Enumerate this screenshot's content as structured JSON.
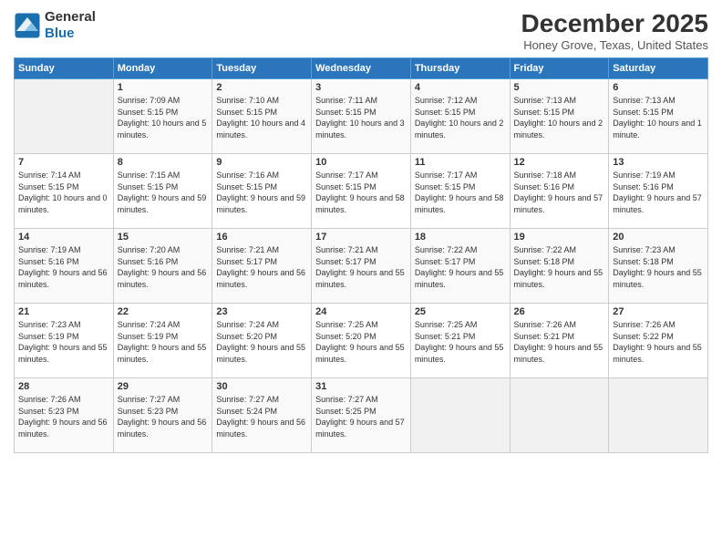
{
  "logo": {
    "line1": "General",
    "line2": "Blue"
  },
  "title": "December 2025",
  "subtitle": "Honey Grove, Texas, United States",
  "days_header": [
    "Sunday",
    "Monday",
    "Tuesday",
    "Wednesday",
    "Thursday",
    "Friday",
    "Saturday"
  ],
  "weeks": [
    [
      {
        "num": "",
        "sunrise": "",
        "sunset": "",
        "daylight": ""
      },
      {
        "num": "1",
        "sunrise": "Sunrise: 7:09 AM",
        "sunset": "Sunset: 5:15 PM",
        "daylight": "Daylight: 10 hours and 5 minutes."
      },
      {
        "num": "2",
        "sunrise": "Sunrise: 7:10 AM",
        "sunset": "Sunset: 5:15 PM",
        "daylight": "Daylight: 10 hours and 4 minutes."
      },
      {
        "num": "3",
        "sunrise": "Sunrise: 7:11 AM",
        "sunset": "Sunset: 5:15 PM",
        "daylight": "Daylight: 10 hours and 3 minutes."
      },
      {
        "num": "4",
        "sunrise": "Sunrise: 7:12 AM",
        "sunset": "Sunset: 5:15 PM",
        "daylight": "Daylight: 10 hours and 2 minutes."
      },
      {
        "num": "5",
        "sunrise": "Sunrise: 7:13 AM",
        "sunset": "Sunset: 5:15 PM",
        "daylight": "Daylight: 10 hours and 2 minutes."
      },
      {
        "num": "6",
        "sunrise": "Sunrise: 7:13 AM",
        "sunset": "Sunset: 5:15 PM",
        "daylight": "Daylight: 10 hours and 1 minute."
      }
    ],
    [
      {
        "num": "7",
        "sunrise": "Sunrise: 7:14 AM",
        "sunset": "Sunset: 5:15 PM",
        "daylight": "Daylight: 10 hours and 0 minutes."
      },
      {
        "num": "8",
        "sunrise": "Sunrise: 7:15 AM",
        "sunset": "Sunset: 5:15 PM",
        "daylight": "Daylight: 9 hours and 59 minutes."
      },
      {
        "num": "9",
        "sunrise": "Sunrise: 7:16 AM",
        "sunset": "Sunset: 5:15 PM",
        "daylight": "Daylight: 9 hours and 59 minutes."
      },
      {
        "num": "10",
        "sunrise": "Sunrise: 7:17 AM",
        "sunset": "Sunset: 5:15 PM",
        "daylight": "Daylight: 9 hours and 58 minutes."
      },
      {
        "num": "11",
        "sunrise": "Sunrise: 7:17 AM",
        "sunset": "Sunset: 5:15 PM",
        "daylight": "Daylight: 9 hours and 58 minutes."
      },
      {
        "num": "12",
        "sunrise": "Sunrise: 7:18 AM",
        "sunset": "Sunset: 5:16 PM",
        "daylight": "Daylight: 9 hours and 57 minutes."
      },
      {
        "num": "13",
        "sunrise": "Sunrise: 7:19 AM",
        "sunset": "Sunset: 5:16 PM",
        "daylight": "Daylight: 9 hours and 57 minutes."
      }
    ],
    [
      {
        "num": "14",
        "sunrise": "Sunrise: 7:19 AM",
        "sunset": "Sunset: 5:16 PM",
        "daylight": "Daylight: 9 hours and 56 minutes."
      },
      {
        "num": "15",
        "sunrise": "Sunrise: 7:20 AM",
        "sunset": "Sunset: 5:16 PM",
        "daylight": "Daylight: 9 hours and 56 minutes."
      },
      {
        "num": "16",
        "sunrise": "Sunrise: 7:21 AM",
        "sunset": "Sunset: 5:17 PM",
        "daylight": "Daylight: 9 hours and 56 minutes."
      },
      {
        "num": "17",
        "sunrise": "Sunrise: 7:21 AM",
        "sunset": "Sunset: 5:17 PM",
        "daylight": "Daylight: 9 hours and 55 minutes."
      },
      {
        "num": "18",
        "sunrise": "Sunrise: 7:22 AM",
        "sunset": "Sunset: 5:17 PM",
        "daylight": "Daylight: 9 hours and 55 minutes."
      },
      {
        "num": "19",
        "sunrise": "Sunrise: 7:22 AM",
        "sunset": "Sunset: 5:18 PM",
        "daylight": "Daylight: 9 hours and 55 minutes."
      },
      {
        "num": "20",
        "sunrise": "Sunrise: 7:23 AM",
        "sunset": "Sunset: 5:18 PM",
        "daylight": "Daylight: 9 hours and 55 minutes."
      }
    ],
    [
      {
        "num": "21",
        "sunrise": "Sunrise: 7:23 AM",
        "sunset": "Sunset: 5:19 PM",
        "daylight": "Daylight: 9 hours and 55 minutes."
      },
      {
        "num": "22",
        "sunrise": "Sunrise: 7:24 AM",
        "sunset": "Sunset: 5:19 PM",
        "daylight": "Daylight: 9 hours and 55 minutes."
      },
      {
        "num": "23",
        "sunrise": "Sunrise: 7:24 AM",
        "sunset": "Sunset: 5:20 PM",
        "daylight": "Daylight: 9 hours and 55 minutes."
      },
      {
        "num": "24",
        "sunrise": "Sunrise: 7:25 AM",
        "sunset": "Sunset: 5:20 PM",
        "daylight": "Daylight: 9 hours and 55 minutes."
      },
      {
        "num": "25",
        "sunrise": "Sunrise: 7:25 AM",
        "sunset": "Sunset: 5:21 PM",
        "daylight": "Daylight: 9 hours and 55 minutes."
      },
      {
        "num": "26",
        "sunrise": "Sunrise: 7:26 AM",
        "sunset": "Sunset: 5:21 PM",
        "daylight": "Daylight: 9 hours and 55 minutes."
      },
      {
        "num": "27",
        "sunrise": "Sunrise: 7:26 AM",
        "sunset": "Sunset: 5:22 PM",
        "daylight": "Daylight: 9 hours and 55 minutes."
      }
    ],
    [
      {
        "num": "28",
        "sunrise": "Sunrise: 7:26 AM",
        "sunset": "Sunset: 5:23 PM",
        "daylight": "Daylight: 9 hours and 56 minutes."
      },
      {
        "num": "29",
        "sunrise": "Sunrise: 7:27 AM",
        "sunset": "Sunset: 5:23 PM",
        "daylight": "Daylight: 9 hours and 56 minutes."
      },
      {
        "num": "30",
        "sunrise": "Sunrise: 7:27 AM",
        "sunset": "Sunset: 5:24 PM",
        "daylight": "Daylight: 9 hours and 56 minutes."
      },
      {
        "num": "31",
        "sunrise": "Sunrise: 7:27 AM",
        "sunset": "Sunset: 5:25 PM",
        "daylight": "Daylight: 9 hours and 57 minutes."
      },
      {
        "num": "",
        "sunrise": "",
        "sunset": "",
        "daylight": ""
      },
      {
        "num": "",
        "sunrise": "",
        "sunset": "",
        "daylight": ""
      },
      {
        "num": "",
        "sunrise": "",
        "sunset": "",
        "daylight": ""
      }
    ]
  ]
}
